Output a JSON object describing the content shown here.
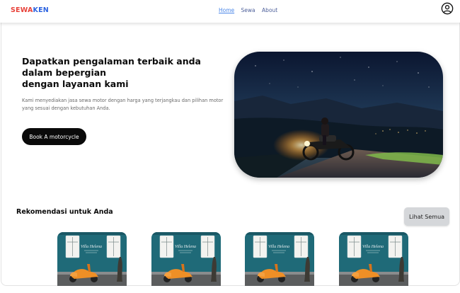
{
  "header": {
    "brand_part1": "SEWA",
    "brand_part2": "KEN",
    "nav": [
      "Home",
      "Sewa",
      "About"
    ],
    "active_nav": "Home",
    "profile_icon": "user-circle-icon"
  },
  "hero": {
    "title": "Dapatkan pengalaman terbaik anda\ndalam bepergian\ndengan layanan kami",
    "description": "Kami menyediakan jasa sewa motor dengan harga yang terjangkau dan pilihan motor yang sesuai dengan kebutuhan Anda.",
    "cta_label": "Book A motorcycle",
    "image": "night-motorcycle-rider-photo"
  },
  "recommendations": {
    "title": "Rekomendasi untuk Anda",
    "see_all_label": "Lihat Semua",
    "cards": [
      {
        "image": "orange-scooter-villa-helena-photo",
        "sign": "Villa Helena"
      },
      {
        "image": "orange-scooter-villa-helena-photo",
        "sign": "Villa Helena"
      },
      {
        "image": "orange-scooter-villa-helena-photo",
        "sign": "Villa Helena"
      },
      {
        "image": "orange-scooter-villa-helena-photo",
        "sign": "Villa Helena"
      }
    ]
  },
  "colors": {
    "brand_red": "#e8423a",
    "brand_blue": "#2c63e0",
    "button_dark": "#0a0a0a",
    "see_all_bg": "#d5d7da"
  }
}
